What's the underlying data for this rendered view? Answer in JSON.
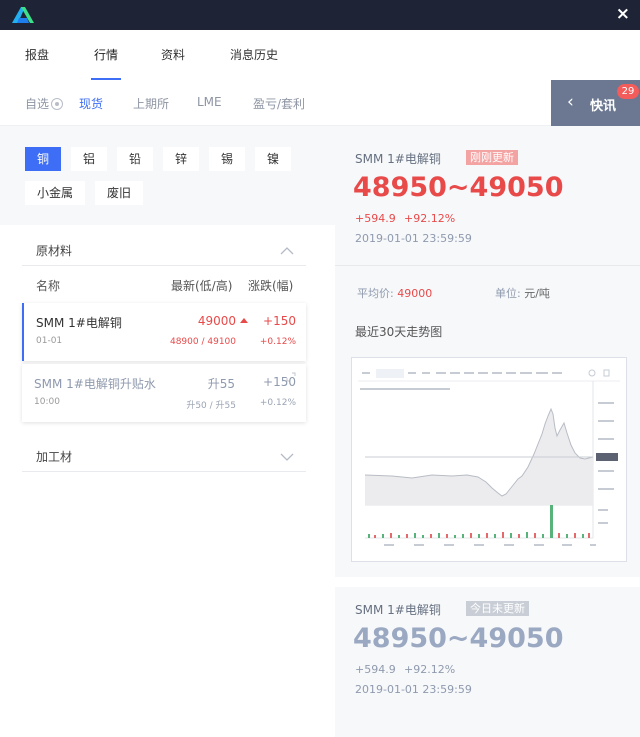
{
  "titlebar": {
    "close": "×"
  },
  "tabs": [
    {
      "label": "报盘"
    },
    {
      "label": "行情"
    },
    {
      "label": "资料"
    },
    {
      "label": "消息历史"
    }
  ],
  "subtabs": {
    "watchlist": "自选",
    "spot": "现货",
    "shfe": "上期所",
    "lme": "LME",
    "arbitrage": "盈亏/套利"
  },
  "kuaixun": {
    "label": "快讯",
    "badge": "29"
  },
  "metals": [
    {
      "label": "铜",
      "active": true
    },
    {
      "label": "铝"
    },
    {
      "label": "铅"
    },
    {
      "label": "锌"
    },
    {
      "label": "锡"
    },
    {
      "label": "镍"
    },
    {
      "label": "小金属"
    },
    {
      "label": "废旧"
    }
  ],
  "raw_section": {
    "title": "原材料"
  },
  "columns": {
    "name": "名称",
    "latest": "最新(低/高)",
    "change": "涨跌(幅)"
  },
  "rows": [
    {
      "name": "SMM 1#电解铜",
      "date": "01-01",
      "price": "49000",
      "range": "48900 / 49100",
      "change": "+150",
      "pct": "+0.12%"
    },
    {
      "name": "SMM 1#电解铜升贴水",
      "date": "10:00",
      "price": "升55",
      "range": "升50 / 升55",
      "change": "+150",
      "pct": "+0.12%"
    }
  ],
  "processed_section": {
    "title": "加工材"
  },
  "detail_top": {
    "name": "SMM 1#电解铜",
    "badge": "刚刚更新",
    "price": "48950~49050",
    "change": "+594.9",
    "pct": "+92.12%",
    "time": "2019-01-01   23:59:59",
    "avg_label": "平均价:",
    "avg_value": "49000",
    "unit_label": "单位:",
    "unit_value": "元/吨",
    "trend_title": "最近30天走势图"
  },
  "detail_bottom": {
    "name": "SMM 1#电解铜",
    "badge": "今日未更新",
    "price": "48950~49050",
    "change": "+594.9",
    "pct": "+92.12%",
    "time": "2019-01-01   23:59:59"
  },
  "colors": {
    "accent": "#3d6ef5",
    "up": "#e84a4a",
    "fresh_badge": "#f4a3a3",
    "stale_badge": "#c8cdd6",
    "titlebar": "#1e2435"
  }
}
